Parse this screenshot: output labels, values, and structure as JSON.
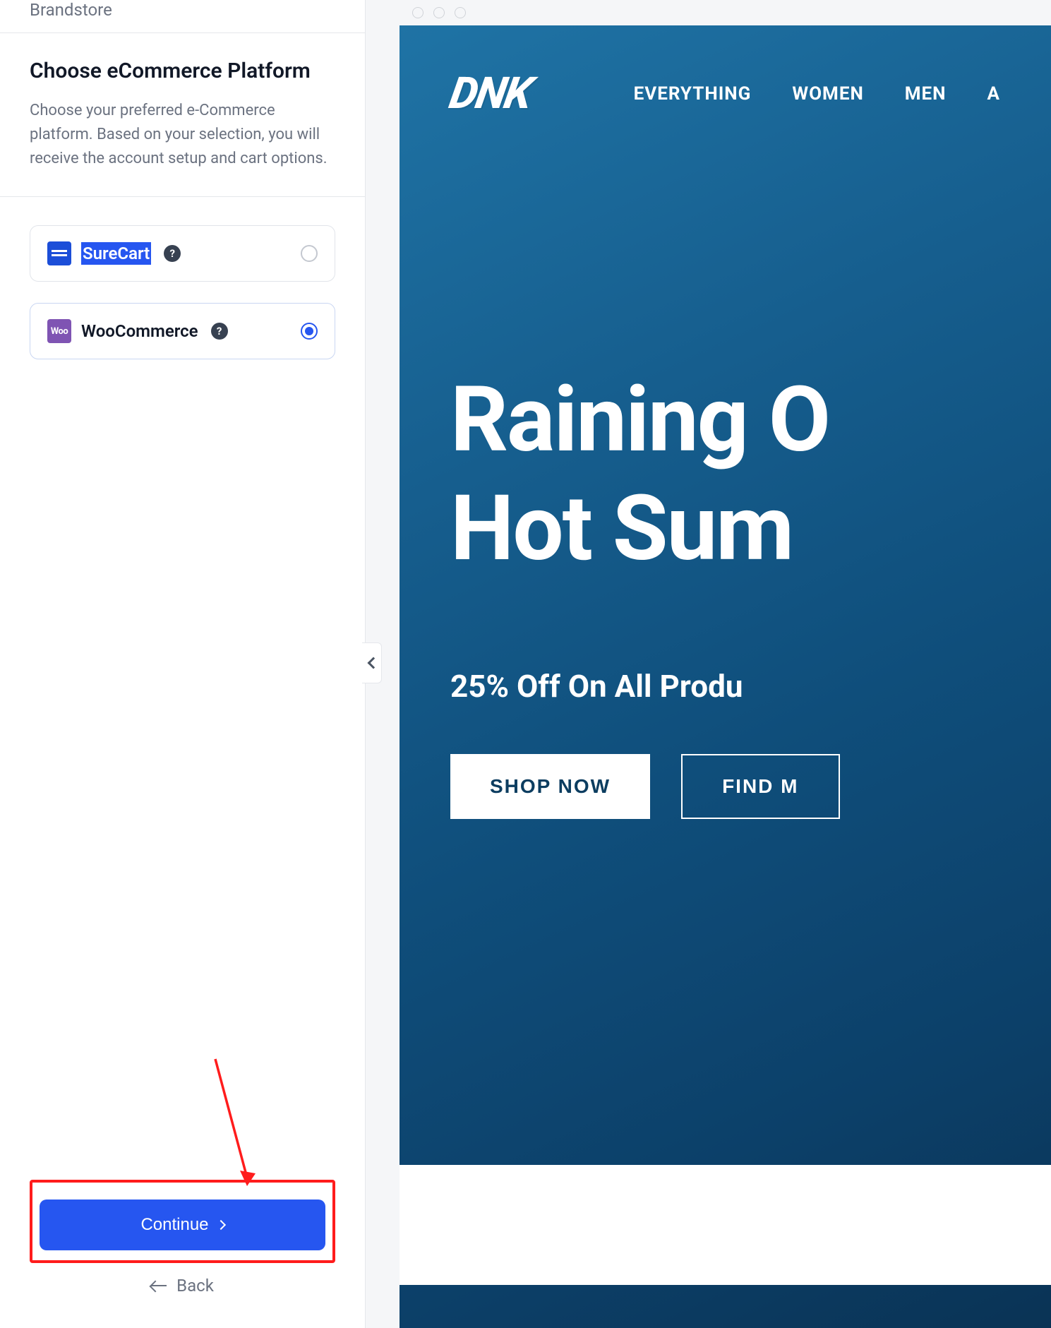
{
  "sidebar": {
    "breadcrumb": "Brandstore",
    "title": "Choose eCommerce Platform",
    "description": "Choose your preferred e-Commerce platform. Based on your selection, you will receive the account setup and cart options.",
    "options": [
      {
        "label": "SureCart",
        "selected": false,
        "icon": "surecart-icon"
      },
      {
        "label": "WooCommerce",
        "selected": true,
        "icon": "woocommerce-icon"
      }
    ],
    "continue_label": "Continue",
    "back_label": "Back"
  },
  "preview": {
    "brand": "DNK",
    "nav": [
      {
        "label": "EVERYTHING"
      },
      {
        "label": "WOMEN"
      },
      {
        "label": "MEN"
      },
      {
        "label": "A"
      }
    ],
    "hero": {
      "line1": "Raining O",
      "line2": "Hot Sum",
      "sub": "25% Off On All Produ",
      "cta_primary": "SHOP NOW",
      "cta_secondary": "FIND M"
    }
  },
  "colors": {
    "accent": "#2656f0",
    "annotation": "#ff1c1c",
    "preview_bg_start": "#1f73a5",
    "preview_bg_end": "#0a3355"
  }
}
